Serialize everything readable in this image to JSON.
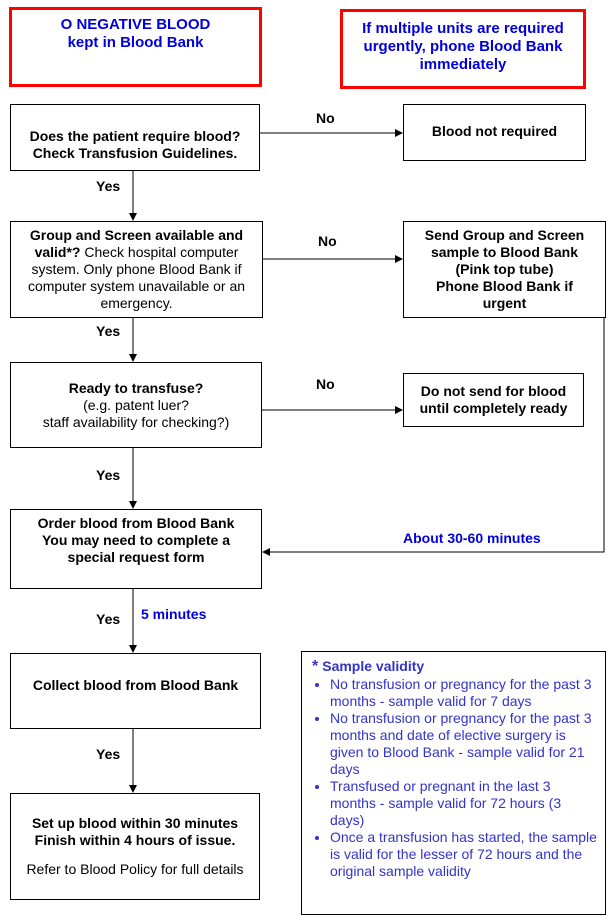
{
  "header": {
    "left_note": {
      "line1": "O NEGATIVE BLOOD",
      "line2": "kept in Blood Bank"
    },
    "right_note": {
      "line1": "If multiple units are required",
      "line2": "urgently, phone Blood Bank",
      "line3": "immediately"
    }
  },
  "steps": {
    "require_blood": {
      "line1": "Does the patient require blood?",
      "line2": "Check Transfusion Guidelines."
    },
    "blood_not_required": {
      "text": "Blood not required"
    },
    "group_screen": {
      "bold": "Group and Screen available and valid*?",
      "normal": " Check hospital computer system. Only phone Blood Bank if computer system unavailable or an emergency."
    },
    "send_sample": {
      "line1": "Send Group and Screen",
      "line2": "sample to Blood Bank",
      "line3": "(Pink top tube)",
      "line4": "Phone Blood Bank if",
      "line5": "urgent"
    },
    "ready": {
      "bold": "Ready to transfuse?",
      "line2": "(e.g. patent luer?",
      "line3": "staff availability for checking?)"
    },
    "do_not_send": {
      "line1": "Do not send for blood",
      "line2": "until completely ready"
    },
    "order": {
      "line1": "Order blood from Blood Bank",
      "line2": "You may need to complete a",
      "line3": "special request form"
    },
    "collect": {
      "text": "Collect blood from Blood Bank"
    },
    "setup": {
      "line1": "Set up blood within 30 minutes",
      "line2": "Finish within 4 hours of issue.",
      "line3": "Refer to Blood Policy for full details"
    }
  },
  "labels": {
    "no1": "No",
    "no2": "No",
    "no3": "No",
    "yes1": "Yes",
    "yes2": "Yes",
    "yes3": "Yes",
    "yes4": "Yes",
    "yes5": "Yes",
    "time_30_60": "About 30-60 minutes",
    "time_5": "5 minutes"
  },
  "validity": {
    "star": "*",
    "title": "Sample validity",
    "items": [
      "No transfusion or pregnancy for the past 3 months - sample valid for 7 days",
      "No transfusion or pregnancy for the past 3 months and date of elective surgery is given to Blood Bank - sample valid for 21 days",
      "Transfused or pregnant in the last 3 months - sample valid for 72 hours (3 days)",
      "Once a transfusion has started, the sample is valid for the lesser of 72 hours and the original sample validity"
    ]
  },
  "colors": {
    "alert_border": "#ff0000",
    "alert_text": "#0000dd",
    "validity_text": "#3333cc"
  }
}
